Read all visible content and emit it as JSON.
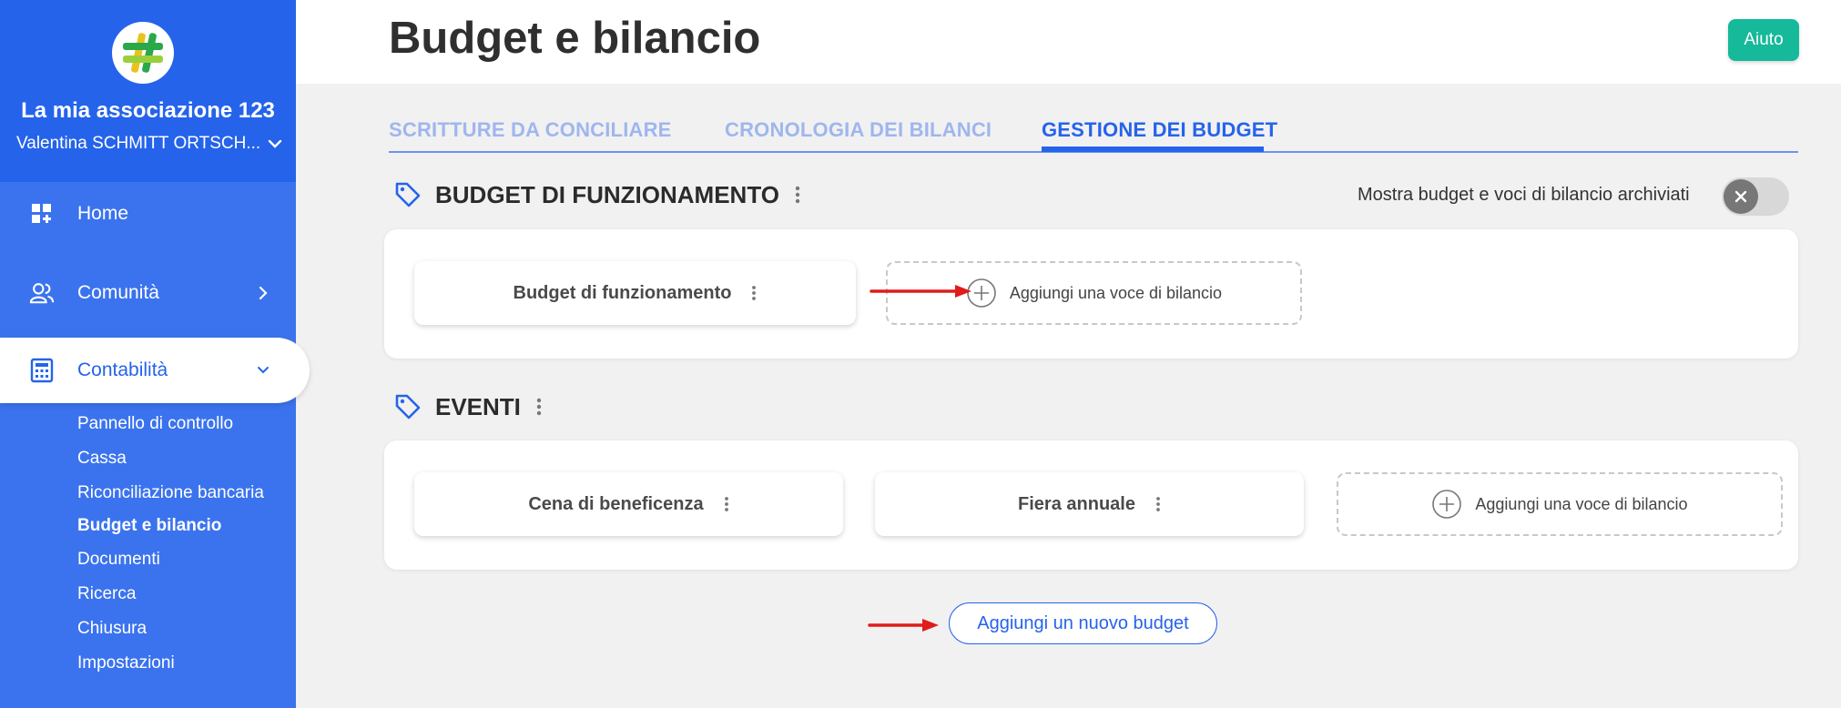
{
  "sidebar": {
    "org_name": "La mia associazione 123",
    "user_name": "Valentina SCHMITT ORTSCH...",
    "nav": [
      {
        "label": "Home",
        "icon": "dashboard-icon"
      },
      {
        "label": "Comunità",
        "icon": "users-icon"
      },
      {
        "label": "Contabilità",
        "icon": "calculator-icon"
      }
    ],
    "sub_items": [
      "Pannello di controllo",
      "Cassa",
      "Riconciliazione bancaria",
      "Budget e bilancio",
      "Documenti",
      "Ricerca",
      "Chiusura",
      "Impostazioni"
    ],
    "active_sub_item": "Budget e bilancio"
  },
  "header": {
    "title": "Budget e bilancio",
    "help_label": "Aiuto"
  },
  "tabs": [
    {
      "label": "SCRITTURE DA CONCILIARE",
      "active": false
    },
    {
      "label": "CRONOLOGIA DEI BILANCI",
      "active": false
    },
    {
      "label": "GESTIONE DEI BUDGET",
      "active": true
    }
  ],
  "archive": {
    "label": "Mostra budget e voci di bilancio archiviati",
    "enabled": false
  },
  "sections": [
    {
      "title": "BUDGET DI FUNZIONAMENTO",
      "cards": [
        "Budget di funzionamento"
      ],
      "add_label": "Aggiungi una voce di bilancio"
    },
    {
      "title": "EVENTI",
      "cards": [
        "Cena di beneficenza",
        "Fiera annuale"
      ],
      "add_label": "Aggiungi una voce di bilancio"
    }
  ],
  "new_budget_label": "Aggiungi un nuovo budget",
  "colors": {
    "sidebar_bg": "#3b73ee",
    "sidebar_top": "#2563eb",
    "accent": "#2563eb",
    "help": "#16b99a",
    "annotation_arrow": "#e01b1b"
  }
}
